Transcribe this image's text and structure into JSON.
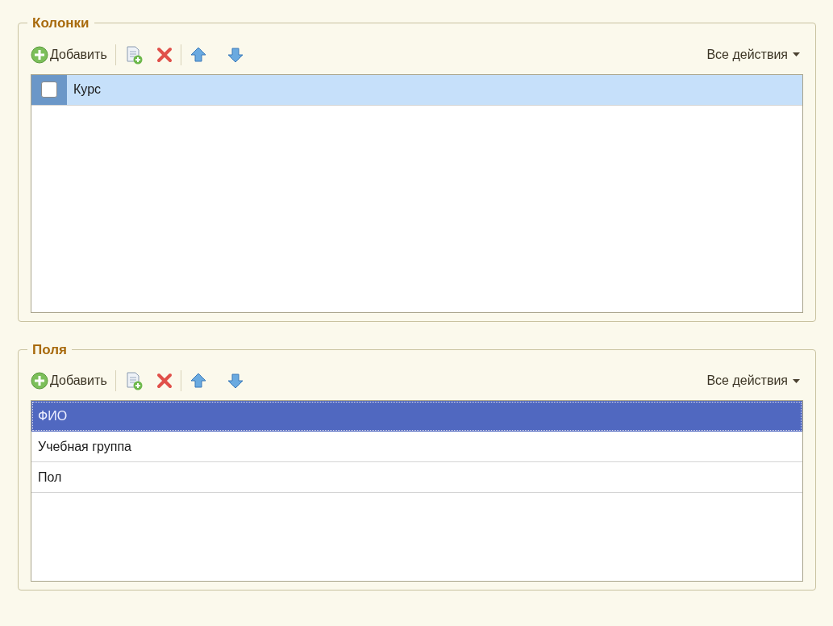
{
  "groups": [
    {
      "title": "Колонки",
      "toolbar": {
        "add_label": "Добавить",
        "all_actions": "Все действия"
      },
      "rows": [
        {
          "kind": "checkbox",
          "label": "Курс",
          "checked": false,
          "selected": true
        }
      ]
    },
    {
      "title": "Поля",
      "toolbar": {
        "add_label": "Добавить",
        "all_actions": "Все действия"
      },
      "rows": [
        {
          "kind": "plain",
          "label": "ФИО",
          "selected": true
        },
        {
          "kind": "plain",
          "label": "Учебная группа",
          "selected": false
        },
        {
          "kind": "plain",
          "label": "Пол",
          "selected": false
        }
      ]
    }
  ]
}
